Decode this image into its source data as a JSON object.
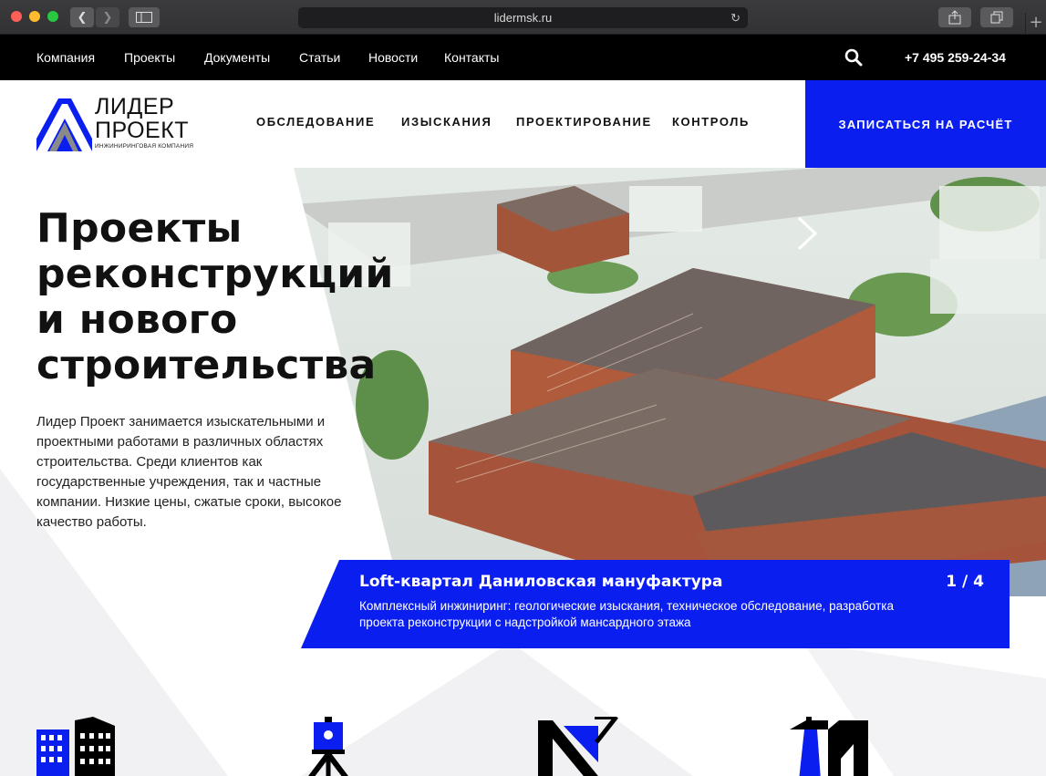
{
  "browser": {
    "url": "lidermsk.ru"
  },
  "topnav": {
    "items": [
      "Компания",
      "Проекты",
      "Документы",
      "Статьи",
      "Новости",
      "Контакты"
    ],
    "phone": "+7 495 259-24-34"
  },
  "logo": {
    "title_line1": "ЛИДЕР",
    "title_line2": "ПРОЕКТ",
    "subtitle": "ИНЖИНИРИНГОВАЯ КОМПАНИЯ"
  },
  "mainnav": {
    "items": [
      "ОБСЛЕДОВАНИЕ",
      "ИЗЫСКАНИЯ",
      "ПРОЕКТИРОВАНИЕ",
      "КОНТРОЛЬ"
    ]
  },
  "cta": {
    "label": "ЗАПИСАТЬСЯ НА РАСЧЁТ"
  },
  "hero": {
    "title_lines": [
      "Проекты",
      "реконструкций",
      "и нового",
      "строительства"
    ],
    "text": "Лидер Проект занимается изыскательными и проектными работами в различных областях строительства. Среди клиентов как государственные учреждения, так и частные компании. Низкие цены, сжатые сроки, высокое качество работы."
  },
  "slide": {
    "title": "Loft-квартал Даниловская мануфактура",
    "counter": "1 / 4",
    "description": "Комплексный инжиниринг: геологические изыскания, техническое обследование, разработка проекта реконструкции с надстройкой мансардного этажа"
  },
  "colors": {
    "brand_blue": "#0a1ef0",
    "black": "#000000"
  },
  "services_icons": [
    "building-icon",
    "survey-tripod-icon",
    "drafting-icon",
    "crane-icon"
  ]
}
